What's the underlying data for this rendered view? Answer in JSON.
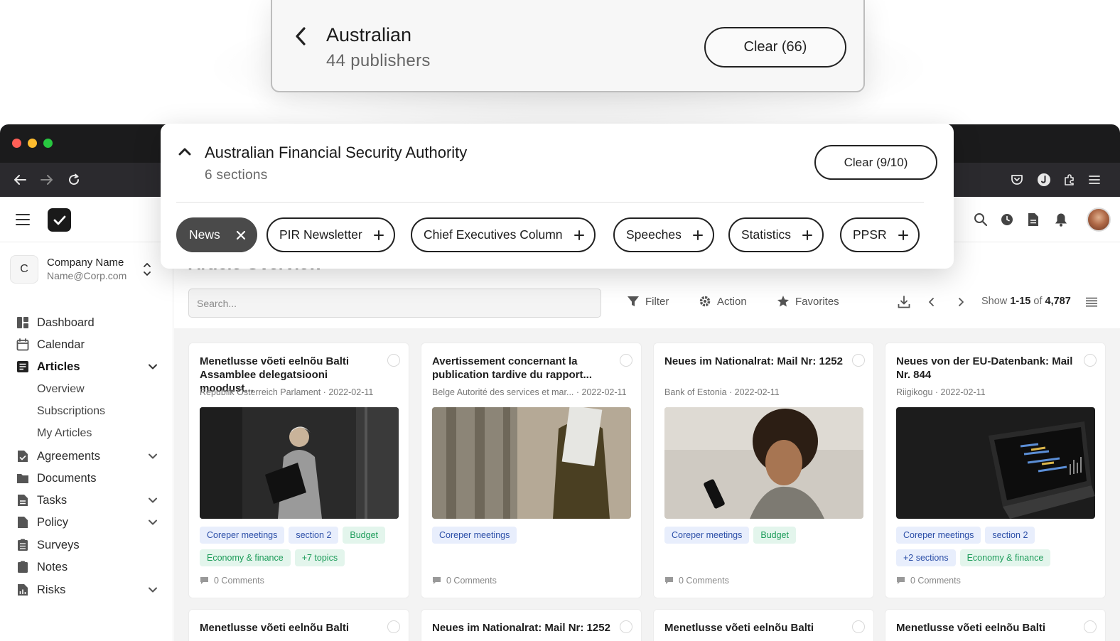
{
  "top_card": {
    "title": "Australian",
    "subtitle": "44 publishers",
    "clear_label": "Clear (66)"
  },
  "popup": {
    "title": "Australian Financial Security Authority",
    "subtitle": "6 sections",
    "clear_label": "Clear (9/10)",
    "chips": [
      {
        "label": "News",
        "selected": true
      },
      {
        "label": "PIR Newsletter",
        "selected": false
      },
      {
        "label": "Chief Executives Column",
        "selected": false
      },
      {
        "label": "Speeches",
        "selected": false
      },
      {
        "label": "Statistics",
        "selected": false
      },
      {
        "label": "PPSR",
        "selected": false
      }
    ]
  },
  "company": {
    "initial": "C",
    "name": "Company Name",
    "email": "Name@Corp.com"
  },
  "sidebar": {
    "items": [
      {
        "label": "Dashboard",
        "icon": "dashboard-icon"
      },
      {
        "label": "Calendar",
        "icon": "calendar-icon"
      },
      {
        "label": "Articles",
        "icon": "articles-icon"
      },
      {
        "label": "Agreements",
        "icon": "agreements-icon"
      },
      {
        "label": "Documents",
        "icon": "folder-icon"
      },
      {
        "label": "Tasks",
        "icon": "tasks-icon"
      },
      {
        "label": "Policy",
        "icon": "policy-icon"
      },
      {
        "label": "Surveys",
        "icon": "surveys-icon"
      },
      {
        "label": "Notes",
        "icon": "notes-icon"
      },
      {
        "label": "Risks",
        "icon": "risks-icon"
      }
    ],
    "sub_items": [
      "Overview",
      "Subscriptions",
      "My Articles"
    ]
  },
  "main": {
    "title": "Article Overview",
    "search_placeholder": "Search...",
    "toolbar": {
      "filter": "Filter",
      "action": "Action",
      "favorites": "Favorites"
    },
    "pagination": {
      "show": "Show",
      "range": "1-15",
      "of": "of",
      "total": "4,787"
    }
  },
  "articles": [
    {
      "title": "Menetlusse võeti eelnõu Balti Assamblee delegatsiooni moodust...",
      "meta": "Republik Österreich Parlament · 2022-02-11",
      "tags": [
        {
          "label": "Coreper meetings",
          "color": "blue"
        },
        {
          "label": "section 2",
          "color": "blue"
        },
        {
          "label": "Budget",
          "color": "green"
        },
        {
          "label": "Economy & finance",
          "color": "green"
        },
        {
          "label": "+7 topics",
          "color": "green"
        }
      ],
      "comments": "0 Comments"
    },
    {
      "title": "Avertissement concernant la publication tardive du rapport...",
      "meta": "Belge Autorité des services et mar... · 2022-02-11",
      "tags": [
        {
          "label": "Coreper meetings",
          "color": "blue"
        }
      ],
      "comments": "0 Comments"
    },
    {
      "title": "Neues im Nationalrat: Mail Nr: 1252",
      "meta": "Bank of Estonia · 2022-02-11",
      "tags": [
        {
          "label": "Coreper meetings",
          "color": "blue"
        },
        {
          "label": "Budget",
          "color": "green"
        }
      ],
      "comments": "0 Comments"
    },
    {
      "title": "Neues von der EU-Datenbank: Mail Nr. 844",
      "meta": "Riigikogu · 2022-02-11",
      "tags": [
        {
          "label": "Coreper meetings",
          "color": "blue"
        },
        {
          "label": "section 2",
          "color": "blue"
        },
        {
          "label": "+2 sections",
          "color": "blue"
        },
        {
          "label": "Economy & finance",
          "color": "green"
        }
      ],
      "comments": "0 Comments"
    }
  ],
  "articles_row2": [
    {
      "title": "Menetlusse võeti eelnõu Balti"
    },
    {
      "title": "Neues im Nationalrat: Mail Nr: 1252"
    },
    {
      "title": "Menetlusse võeti eelnõu Balti"
    },
    {
      "title": "Menetlusse võeti eelnõu Balti"
    }
  ],
  "colors": {
    "accent_blue": "#2c4fa8",
    "accent_green": "#1d9c5a",
    "chip_selected": "#4a4a4a",
    "chrome_dark": "#1b1b1c"
  }
}
